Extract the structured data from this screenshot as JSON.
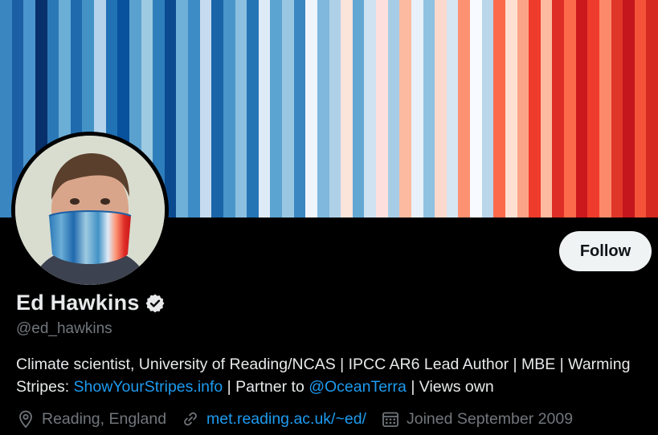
{
  "banner": {
    "stripe_colors": [
      "#3a86c0",
      "#1c5fa4",
      "#4a95cd",
      "#08306b",
      "#2b78b7",
      "#6baed6",
      "#1f69ad",
      "#4292c6",
      "#b5d3ea",
      "#2171b5",
      "#08519c",
      "#5aa1d0",
      "#9ecae1",
      "#2e7ebc",
      "#0b4a8f",
      "#6fb0d8",
      "#3d8cc5",
      "#c6dbef",
      "#1a64a8",
      "#4a96cb",
      "#8cc0e0",
      "#2475b4",
      "#deebf7",
      "#5ba3d1",
      "#99c7e2",
      "#3b87c1",
      "#f0f5fb",
      "#7fb8dc",
      "#aed1e8",
      "#fbe4da",
      "#63a7d3",
      "#cfe2f1",
      "#fde0dd",
      "#a7cde6",
      "#fcbba1",
      "#e8f1f9",
      "#8fc2e0",
      "#fcd9cd",
      "#d6e6f3",
      "#fc9272",
      "#f7fbff",
      "#b9d6eb",
      "#fb6a4a",
      "#fee0d2",
      "#fca487",
      "#ef3b2c",
      "#fcbba1",
      "#de2d26",
      "#fb6a4a",
      "#cb181d",
      "#ef3b2c",
      "#fc8a6a",
      "#e0362a",
      "#c4161c",
      "#f4533a",
      "#d42a22"
    ]
  },
  "profile": {
    "name": "Ed Hawkins",
    "handle": "@ed_hawkins",
    "follow_label": "Follow",
    "bio": {
      "part1": "Climate scientist, University of Reading/NCAS | IPCC AR6 Lead Author | MBE | Warming Stripes: ",
      "link1": "ShowYourStripes.info",
      "part2": " | Partner to ",
      "mention": "@OceanTerra",
      "part3": " | Views own"
    },
    "location": "Reading, England",
    "website": "met.reading.ac.uk/~ed/",
    "joined": "Joined September 2009"
  },
  "icons": {
    "verified": "verified-badge-icon",
    "location": "location-pin-icon",
    "link": "link-icon",
    "calendar": "calendar-icon"
  },
  "colors": {
    "link": "#1d9bf0",
    "muted": "#71767b",
    "text": "#e7e9ea",
    "background": "#000000",
    "button_bg": "#eff3f4"
  }
}
